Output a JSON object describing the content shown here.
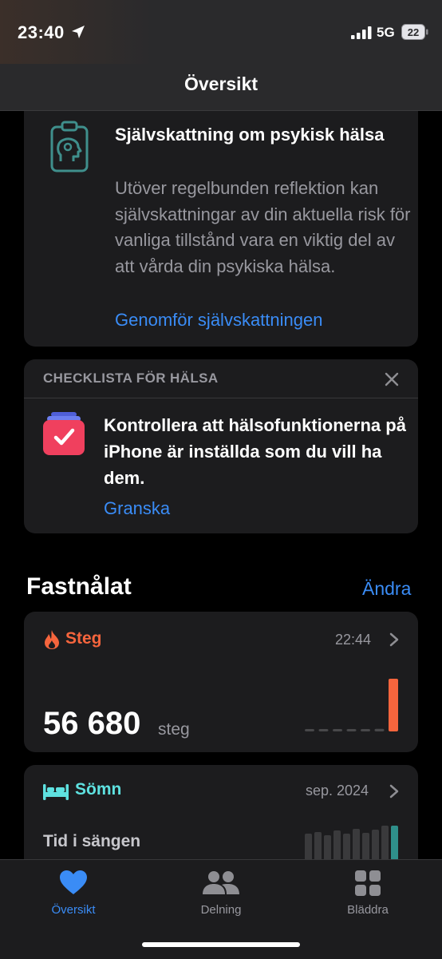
{
  "status": {
    "time": "23:40",
    "network": "5G",
    "battery": "22"
  },
  "nav": {
    "title": "Översikt"
  },
  "assessment_card": {
    "icon": "clipboard-brain-icon",
    "title": "Självskattning om psykisk hälsa",
    "body": "Utöver regelbunden reflektion kan självskattningar av din aktuella risk för vanliga tillstånd vara en viktig del av att vårda din psykiska hälsa.",
    "link": "Genomför självskattningen"
  },
  "checklist_card": {
    "header": "CHECKLISTA FÖR HÄLSA",
    "icon": "checklist-icon",
    "text": "Kontrollera att hälsofunktionerna på iPhone är inställda som du vill ha dem.",
    "link": "Granska"
  },
  "pinned": {
    "title": "Fastnålat",
    "edit_label": "Ändra"
  },
  "steps_card": {
    "label": "Steg",
    "time": "22:44",
    "value": "56 680",
    "unit": "steg",
    "bars": [
      0.02,
      0.03,
      0.04,
      0.03,
      0.04,
      0.05,
      1.0
    ],
    "accent": "#f6653d"
  },
  "sleep_card": {
    "label": "Sömn",
    "date": "sep. 2024",
    "subtitle": "Tid i sängen",
    "accent": "#5ee1e0"
  },
  "tabbar": {
    "tabs": [
      {
        "label": "Översikt",
        "icon": "heart-icon",
        "active": true
      },
      {
        "label": "Delning",
        "icon": "people-icon",
        "active": false
      },
      {
        "label": "Bläddra",
        "icon": "grid-icon",
        "active": false
      }
    ]
  }
}
